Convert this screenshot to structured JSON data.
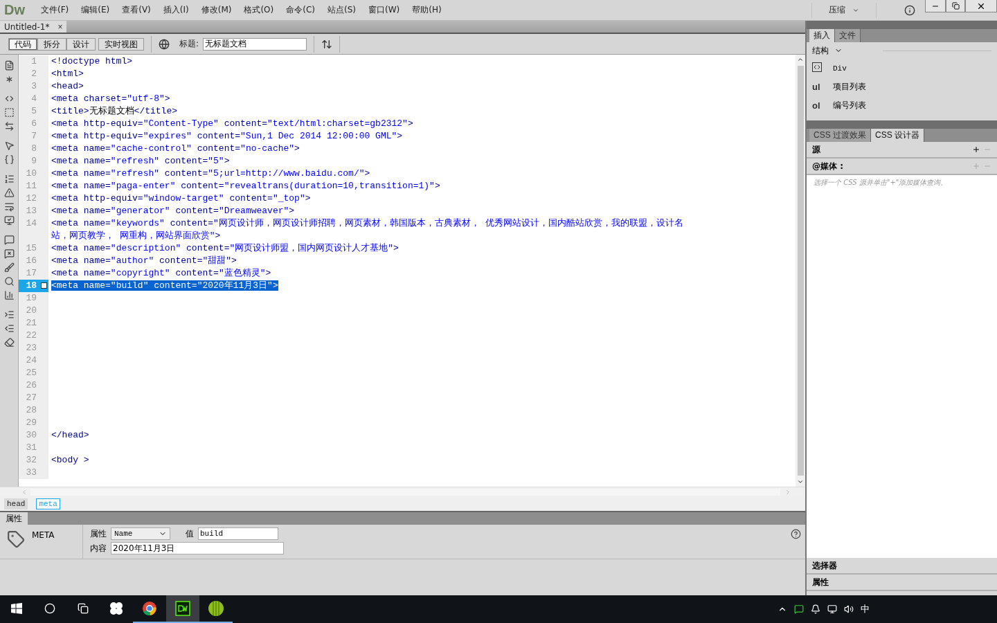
{
  "app": {
    "logo": "Dw",
    "menu": [
      "文件(F)",
      "编辑(E)",
      "查看(V)",
      "插入(I)",
      "修改(M)",
      "格式(O)",
      "命令(C)",
      "站点(S)",
      "窗口(W)",
      "帮助(H)"
    ],
    "workspace": "压缩"
  },
  "document_tab": {
    "label": "Untitled-1*",
    "close": "×"
  },
  "toolbar": {
    "views": [
      {
        "label": "代码",
        "selected": true
      },
      {
        "label": "拆分",
        "selected": false
      },
      {
        "label": "设计",
        "selected": false
      },
      {
        "label": "实时视图",
        "selected": false
      }
    ],
    "title_label": "标题:",
    "title_value": "无标题文档"
  },
  "code": [
    {
      "number": "1",
      "selected": false,
      "tokens": [
        {
          "kind": "tag",
          "text": "<!doctype html>"
        }
      ]
    },
    {
      "number": "2",
      "selected": false,
      "tokens": [
        {
          "kind": "tag",
          "text": "<html>"
        }
      ]
    },
    {
      "number": "3",
      "selected": false,
      "tokens": [
        {
          "kind": "tag",
          "text": "<head>"
        }
      ]
    },
    {
      "number": "4",
      "selected": false,
      "tokens": [
        {
          "kind": "tag",
          "text": "<meta charset="
        },
        {
          "kind": "value",
          "text": "\"utf-8\""
        },
        {
          "kind": "tag",
          "text": ">"
        }
      ]
    },
    {
      "number": "5",
      "selected": false,
      "tokens": [
        {
          "kind": "tag",
          "text": "<title>"
        },
        {
          "kind": "text",
          "text": "无标题文档"
        },
        {
          "kind": "tag",
          "text": "</title>"
        }
      ]
    },
    {
      "number": "6",
      "selected": false,
      "tokens": [
        {
          "kind": "tag",
          "text": "<meta http-equiv="
        },
        {
          "kind": "value",
          "text": "\"Content-Type\""
        },
        {
          "kind": "tag",
          "text": " content="
        },
        {
          "kind": "value",
          "text": "\"text/html:charset=gb2312\""
        },
        {
          "kind": "tag",
          "text": ">"
        }
      ]
    },
    {
      "number": "7",
      "selected": false,
      "tokens": [
        {
          "kind": "tag",
          "text": "<meta http-equiv="
        },
        {
          "kind": "value",
          "text": "\"expires\""
        },
        {
          "kind": "tag",
          "text": " content="
        },
        {
          "kind": "value",
          "text": "\"Sun,1 Dec 2014 12:00:00 GML\""
        },
        {
          "kind": "tag",
          "text": ">"
        }
      ]
    },
    {
      "number": "8",
      "selected": false,
      "tokens": [
        {
          "kind": "tag",
          "text": "<meta name="
        },
        {
          "kind": "value",
          "text": "\"cache-control\""
        },
        {
          "kind": "tag",
          "text": " content="
        },
        {
          "kind": "value",
          "text": "\"no-cache\""
        },
        {
          "kind": "tag",
          "text": ">"
        }
      ]
    },
    {
      "number": "9",
      "selected": false,
      "tokens": [
        {
          "kind": "tag",
          "text": "<meta name="
        },
        {
          "kind": "value",
          "text": "\"refresh\""
        },
        {
          "kind": "tag",
          "text": " content="
        },
        {
          "kind": "value",
          "text": "\"5\""
        },
        {
          "kind": "tag",
          "text": ">"
        }
      ]
    },
    {
      "number": "10",
      "selected": false,
      "tokens": [
        {
          "kind": "tag",
          "text": "<meta name="
        },
        {
          "kind": "value",
          "text": "\"refresh\""
        },
        {
          "kind": "tag",
          "text": " content="
        },
        {
          "kind": "value",
          "text": "\"5;url=http://www.baidu.com/\""
        },
        {
          "kind": "tag",
          "text": ">"
        }
      ]
    },
    {
      "number": "11",
      "selected": false,
      "tokens": [
        {
          "kind": "tag",
          "text": "<meta name="
        },
        {
          "kind": "value",
          "text": "\"paga-enter\""
        },
        {
          "kind": "tag",
          "text": " content="
        },
        {
          "kind": "value",
          "text": "\"revealtrans(duration=10,transition=1)\""
        },
        {
          "kind": "tag",
          "text": ">"
        }
      ]
    },
    {
      "number": "12",
      "selected": false,
      "tokens": [
        {
          "kind": "tag",
          "text": "<meta http-equiv="
        },
        {
          "kind": "value",
          "text": "\"window-target\""
        },
        {
          "kind": "tag",
          "text": " content="
        },
        {
          "kind": "value",
          "text": "\"_top\""
        },
        {
          "kind": "tag",
          "text": ">"
        }
      ]
    },
    {
      "number": "13",
      "selected": false,
      "tokens": [
        {
          "kind": "tag",
          "text": "<meta name="
        },
        {
          "kind": "value",
          "text": "\"generator\""
        },
        {
          "kind": "tag",
          "text": " content="
        },
        {
          "kind": "value",
          "text": "\"Dreamweaver\""
        },
        {
          "kind": "tag",
          "text": ">"
        }
      ]
    },
    {
      "number": "14",
      "selected": false,
      "tokens": [
        {
          "kind": "tag",
          "text": "<meta name="
        },
        {
          "kind": "value",
          "text": "\"keywords\""
        },
        {
          "kind": "tag",
          "text": " content="
        },
        {
          "kind": "value",
          "text": "\"网页设计师，网页设计师招聘，网页素材，韩国版本，古典素材， 优秀网站设计，国内酷站欣赏，我的联盟，设计名站，网页教学， 网重构，网站界面欣赏\""
        },
        {
          "kind": "tag",
          "text": ">"
        }
      ]
    },
    {
      "number": "15",
      "selected": false,
      "tokens": [
        {
          "kind": "tag",
          "text": "<meta name="
        },
        {
          "kind": "value",
          "text": "\"description\""
        },
        {
          "kind": "tag",
          "text": " content="
        },
        {
          "kind": "value",
          "text": "\"网页设计师盟，国内网页设计人才基地\""
        },
        {
          "kind": "tag",
          "text": ">"
        }
      ]
    },
    {
      "number": "16",
      "selected": false,
      "tokens": [
        {
          "kind": "tag",
          "text": "<meta name="
        },
        {
          "kind": "value",
          "text": "\"author\""
        },
        {
          "kind": "tag",
          "text": " content="
        },
        {
          "kind": "value",
          "text": "\"甜甜\""
        },
        {
          "kind": "tag",
          "text": ">"
        }
      ]
    },
    {
      "number": "17",
      "selected": false,
      "tokens": [
        {
          "kind": "tag",
          "text": "<meta name="
        },
        {
          "kind": "value",
          "text": "\"copyright\""
        },
        {
          "kind": "tag",
          "text": " content="
        },
        {
          "kind": "value",
          "text": "\"蓝色精灵\""
        },
        {
          "kind": "tag",
          "text": ">"
        }
      ]
    },
    {
      "number": "18",
      "selected": true,
      "tokens": [
        {
          "kind": "tag",
          "text": "<meta name="
        },
        {
          "kind": "value",
          "text": "\"build\""
        },
        {
          "kind": "tag",
          "text": " content="
        },
        {
          "kind": "value",
          "text": "\"2020年11月3日\""
        },
        {
          "kind": "tag",
          "text": ">"
        }
      ]
    },
    {
      "number": "19",
      "selected": false
    },
    {
      "number": "20",
      "selected": false
    },
    {
      "number": "21",
      "selected": false
    },
    {
      "number": "22",
      "selected": false
    },
    {
      "number": "23",
      "selected": false
    },
    {
      "number": "24",
      "selected": false
    },
    {
      "number": "25",
      "selected": false
    },
    {
      "number": "26",
      "selected": false
    },
    {
      "number": "27",
      "selected": false
    },
    {
      "number": "28",
      "selected": false
    },
    {
      "number": "29",
      "selected": false
    },
    {
      "number": "30",
      "selected": false,
      "tokens": [
        {
          "kind": "tag",
          "text": "</head>"
        }
      ]
    },
    {
      "number": "31",
      "selected": false
    },
    {
      "number": "32",
      "selected": false,
      "tokens": [
        {
          "kind": "tag",
          "text": "<body >"
        }
      ]
    },
    {
      "number": "33",
      "selected": false
    }
  ],
  "tag_selector": [
    {
      "label": "head",
      "selected": false
    },
    {
      "label": "meta",
      "selected": true
    }
  ],
  "properties": {
    "tab": "属性",
    "element": "META",
    "attribute_label": "属性",
    "attribute_value": "Name",
    "value_label": "值",
    "value": "build",
    "content_label": "内容",
    "content": "2020年11月3日"
  },
  "insert_panel": {
    "tabs": [
      {
        "label": "插入",
        "selected": true
      },
      {
        "label": "文件",
        "selected": false
      }
    ],
    "category": "结构",
    "items": [
      {
        "kind": "icon",
        "label": "Div"
      },
      {
        "kind": "text",
        "badge": "ul",
        "label": "项目列表"
      },
      {
        "kind": "text",
        "badge": "ol",
        "label": "编号列表"
      }
    ]
  },
  "css_panel": {
    "tabs": [
      {
        "label": "CSS 过渡效果",
        "selected": false
      },
      {
        "label": "CSS 设计器",
        "selected": true
      }
    ],
    "sources": "源",
    "media": "@媒体 :",
    "hint": "选择一个 CSS 源并单击\"+\"添加媒体查询。",
    "selectors": "选择器",
    "properties": "属性"
  },
  "taskbar": {
    "ime": "中"
  }
}
